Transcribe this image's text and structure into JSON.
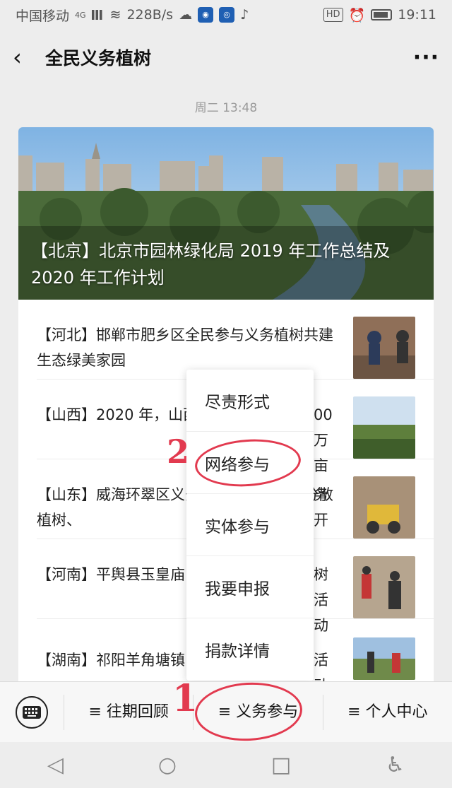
{
  "status_bar": {
    "carrier": "中国移动",
    "network": "4G",
    "speed": "228B/s",
    "hd": "HD",
    "time": "19:11"
  },
  "nav": {
    "title": "全民义务植树",
    "back_icon": "back-arrow-icon",
    "more_icon": "more-icon"
  },
  "timestamp": "周二 13:48",
  "hero": {
    "title": "【北京】北京市园林绿化局 2019 年工作总结及 2020 年工作计划"
  },
  "articles": [
    {
      "title": "【河北】邯郸市肥乡区全民参与义务植树共建生态绿美家园"
    },
    {
      "title": "【山西】2020 年，山西"
    },
    {
      "title": "【山东】威海环翠区义务植树开始，采取分散植树、"
    },
    {
      "title": "【河南】平舆县玉皇庙"
    },
    {
      "title": "【湖南】祁阳羊角塘镇"
    }
  ],
  "article_overflow": [
    "00 万亩",
    "务开",
    "树活动",
    "活动"
  ],
  "popup_menu": [
    "尽责形式",
    "网络参与",
    "实体参与",
    "我要申报",
    "捐款详情"
  ],
  "bottom_tabs": [
    "≡ 往期回顾",
    "≡ 义务参与",
    "≡ 个人中心"
  ],
  "annotations": {
    "step1": "1",
    "step2": "2"
  },
  "colors": {
    "annotation": "#e23a4f",
    "background": "#ededed"
  }
}
